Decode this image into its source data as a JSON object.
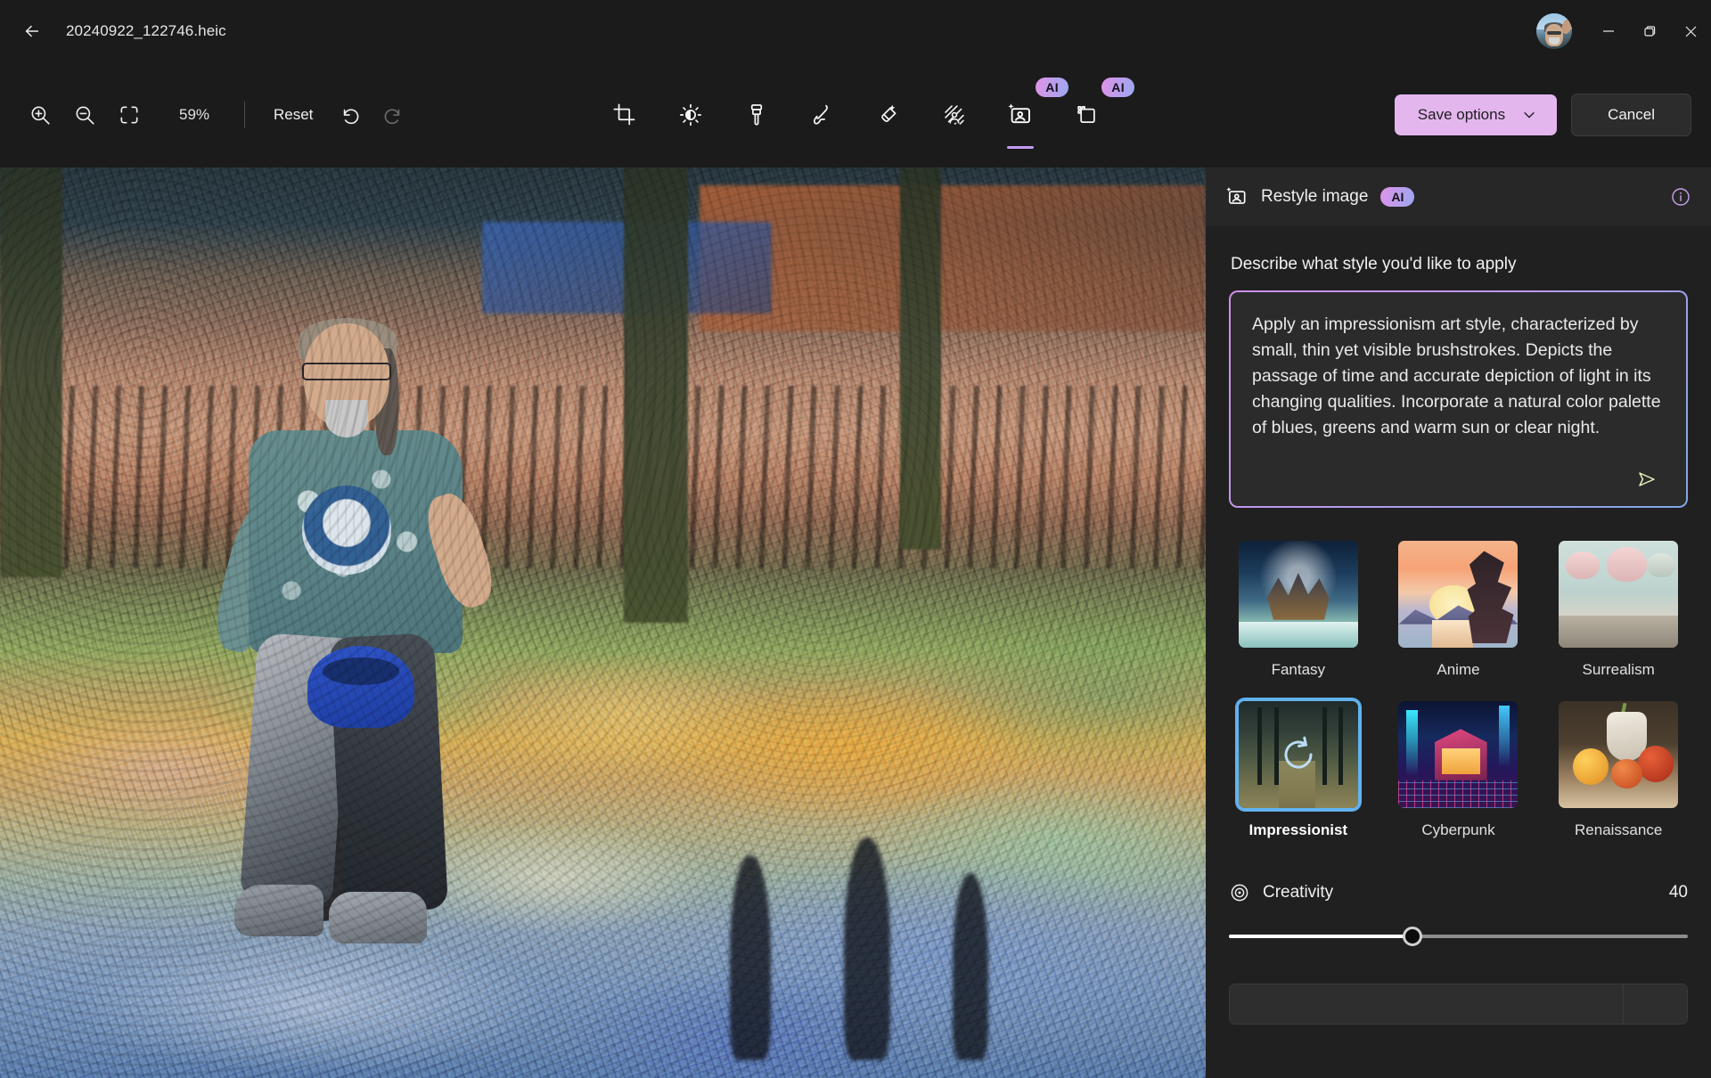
{
  "window": {
    "title": "20240922_122746.heic",
    "back_icon": "arrow-left-icon",
    "avatar_icon": "user-avatar",
    "minimize_label": "–",
    "maximize_label": "❐",
    "close_label": "✕"
  },
  "toolbar": {
    "zoom_in_icon": "zoom-in-icon",
    "zoom_out_icon": "zoom-out-icon",
    "fit_icon": "fit-to-screen-icon",
    "zoom_percent": "59%",
    "reset_label": "Reset",
    "undo_icon": "undo-icon",
    "redo_icon": "redo-icon",
    "tools": [
      {
        "name": "crop",
        "icon": "crop-icon",
        "ai": false,
        "active": false
      },
      {
        "name": "adjustment",
        "icon": "brightness-icon",
        "ai": false,
        "active": false
      },
      {
        "name": "filters",
        "icon": "paintbrush-icon",
        "ai": false,
        "active": false
      },
      {
        "name": "markup",
        "icon": "pen-icon",
        "ai": false,
        "active": false
      },
      {
        "name": "erase",
        "icon": "magic-eraser-icon",
        "ai": false,
        "active": false
      },
      {
        "name": "background",
        "icon": "background-blur-icon",
        "ai": false,
        "active": false
      },
      {
        "name": "restyle-image",
        "icon": "restyle-image-icon",
        "ai": true,
        "active": true
      },
      {
        "name": "generative-erase",
        "icon": "generative-erase-icon",
        "ai": true,
        "active": false
      }
    ],
    "ai_badge_label": "AI",
    "save_label": "Save options",
    "save_caret_icon": "chevron-down-icon",
    "cancel_label": "Cancel"
  },
  "panel": {
    "header_icon": "restyle-image-icon",
    "header_title": "Restyle image",
    "header_ai_badge": "AI",
    "info_icon": "info-icon",
    "prompt_label": "Describe what style you'd like to apply",
    "prompt_text": "Apply an impressionism art style, characterized by small, thin yet visible brushstrokes. Depicts the passage of time and accurate depiction of light in its changing qualities. Incorporate a natural color palette of blues, greens and warm sun or clear night.",
    "send_icon": "send-icon",
    "styles": [
      {
        "label": "Fantasy",
        "art": "th-fantasy",
        "selected": false
      },
      {
        "label": "Anime",
        "art": "th-anime",
        "selected": false
      },
      {
        "label": "Surrealism",
        "art": "th-surreal",
        "selected": false
      },
      {
        "label": "Impressionist",
        "art": "th-imp",
        "selected": true
      },
      {
        "label": "Cyberpunk",
        "art": "th-cyber",
        "selected": false
      },
      {
        "label": "Renaissance",
        "art": "th-ren",
        "selected": false
      }
    ],
    "selected_style_overlay_icon": "refresh-icon",
    "creativity_icon": "target-icon",
    "creativity_label": "Creativity",
    "creativity_value": "40",
    "creativity_percent": 40
  },
  "canvas": {
    "alt": "impressionist-restyled-photo-of-man-seated-outdoors"
  },
  "colors": {
    "accent_purple": "#c39bf0",
    "save_button": "#e3b6ed",
    "selection_blue": "#62b2f0",
    "panel_bg": "#202020",
    "app_bg": "#1b1b1b"
  }
}
